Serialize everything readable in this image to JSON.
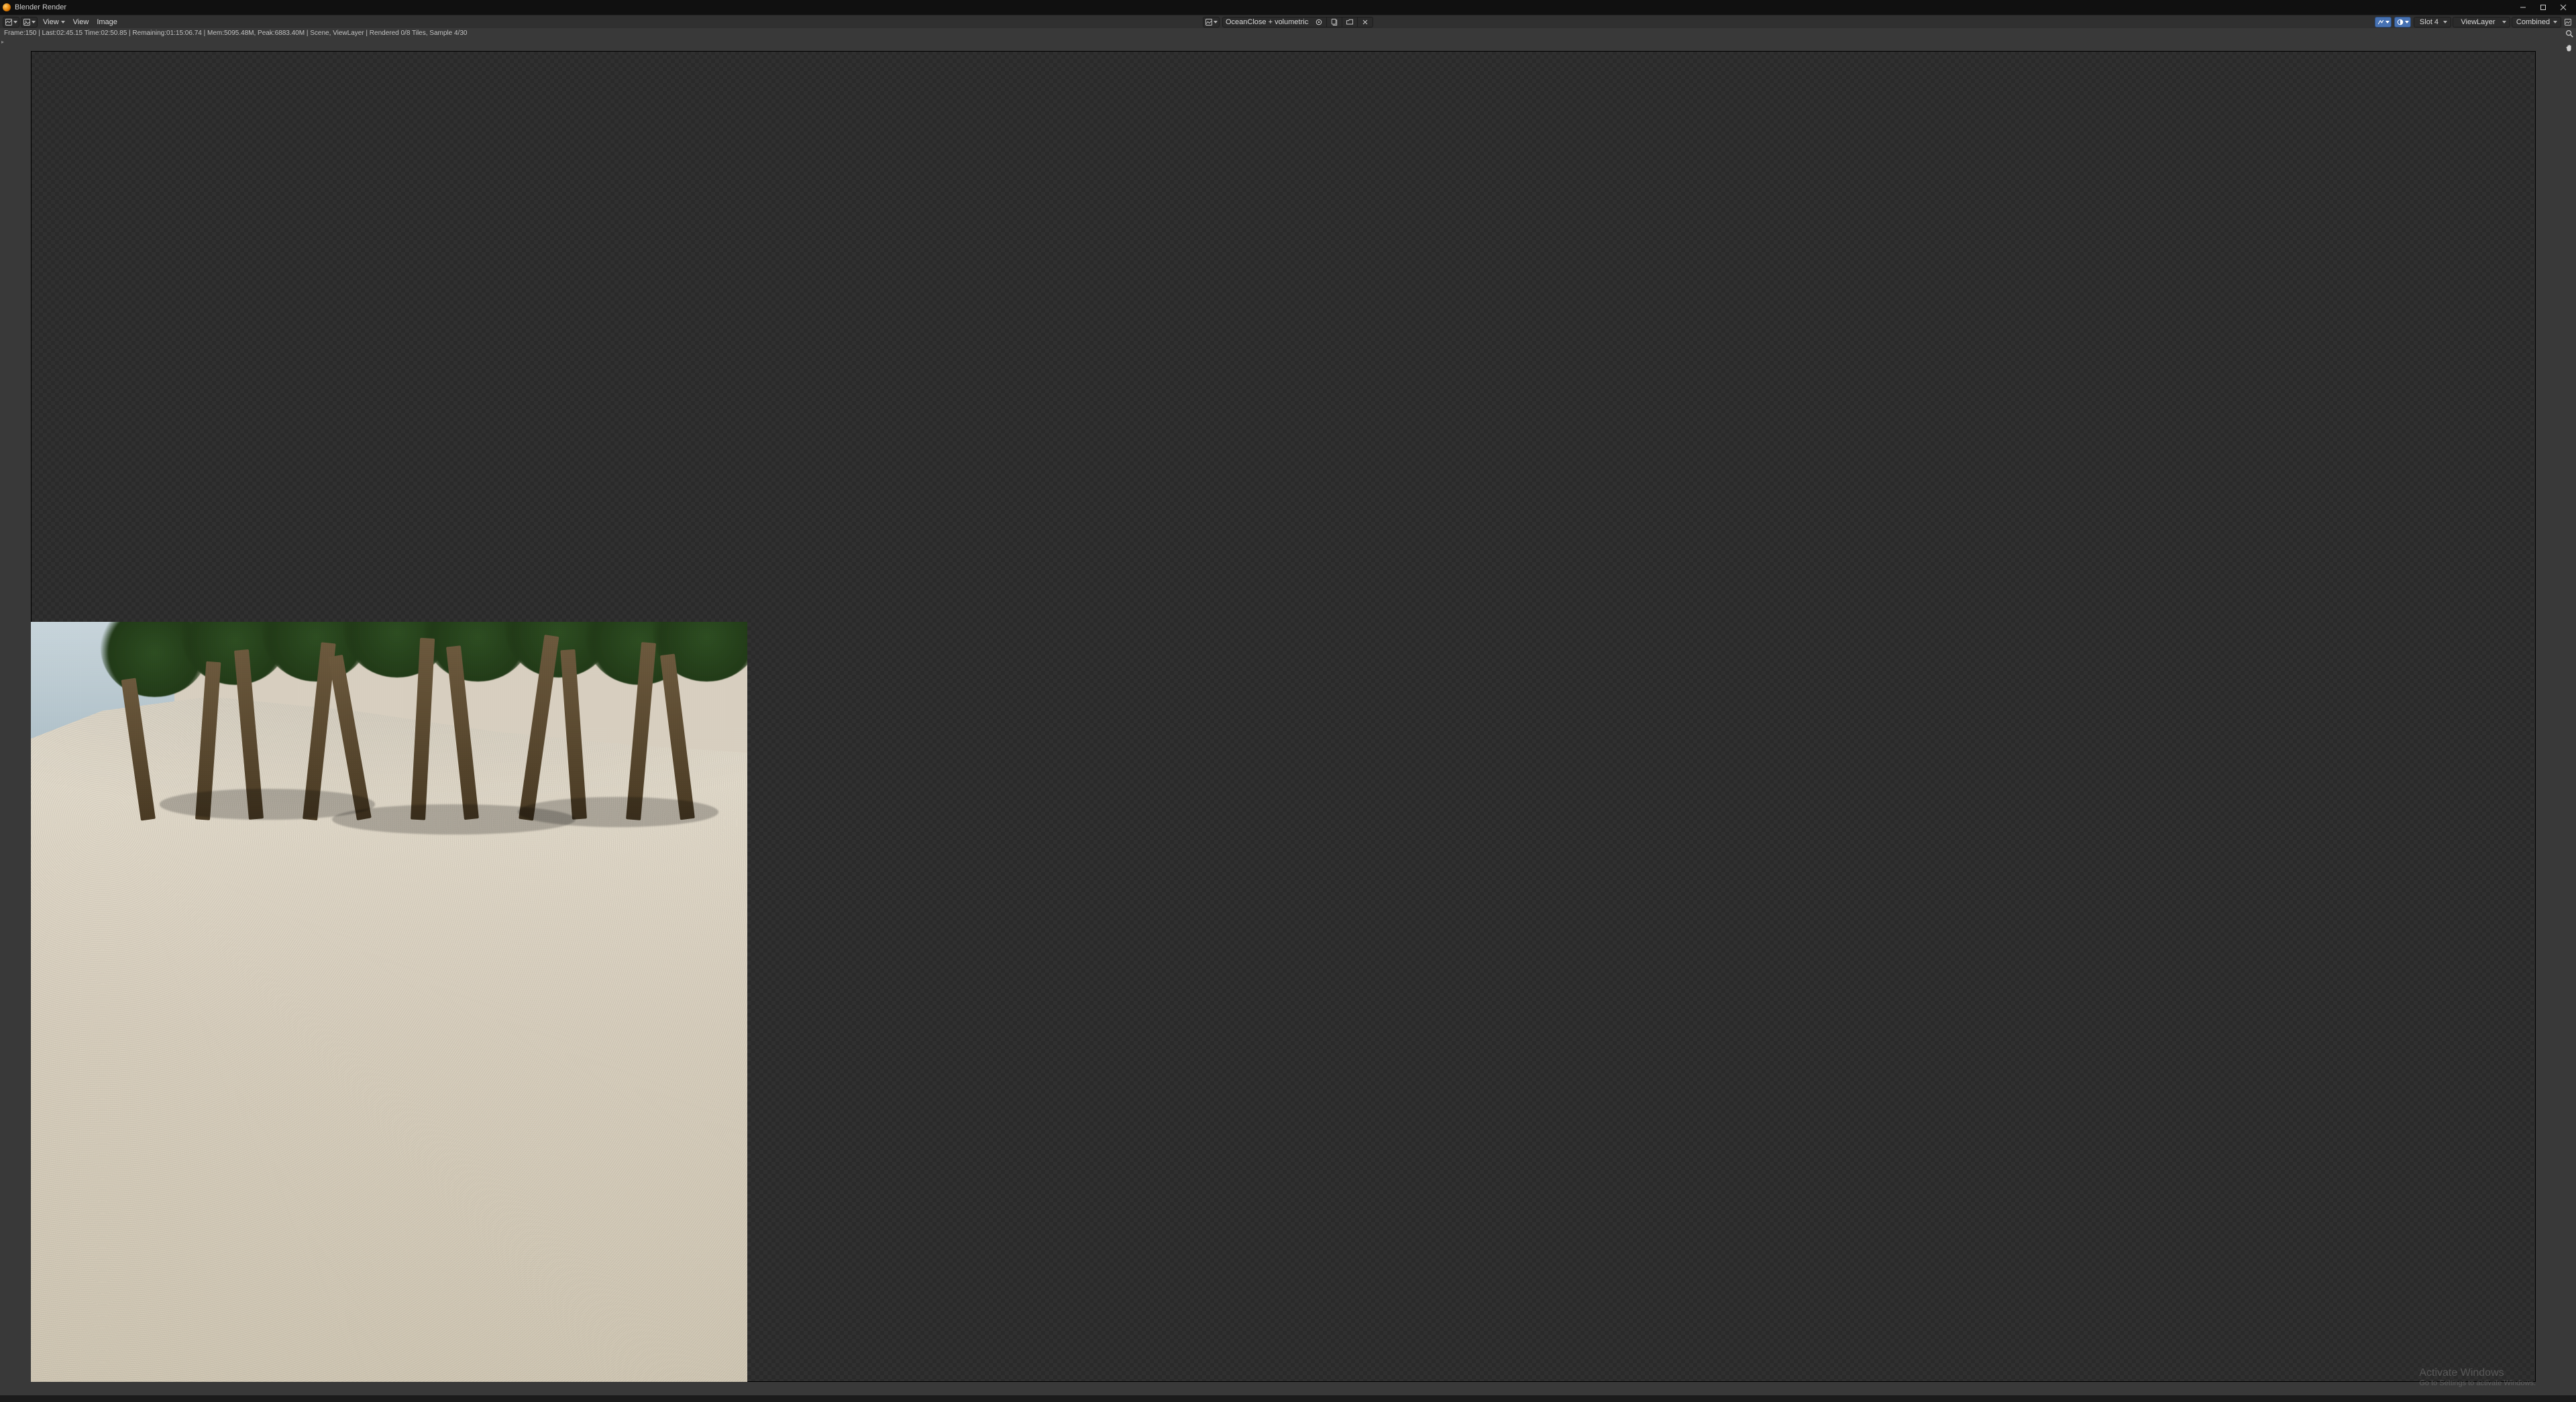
{
  "window": {
    "title": "Blender Render"
  },
  "header": {
    "menus": {
      "view_dd": "View",
      "view": "View",
      "image": "Image"
    },
    "image_name": "OceanClose + volumetrics",
    "slot": "Slot 4",
    "layer": "ViewLayer",
    "pass": "Combined"
  },
  "status": {
    "line": "Frame:150 | Last:02:45.15 Time:02:50.85 | Remaining:01:15:06.74 | Mem:5095.48M, Peak:6883.40M | Scene, ViewLayer | Rendered 0/8 Tiles, Sample 4/30"
  },
  "watermark": {
    "line1": "Activate Windows",
    "line2": "Go to Settings to activate Windows."
  }
}
